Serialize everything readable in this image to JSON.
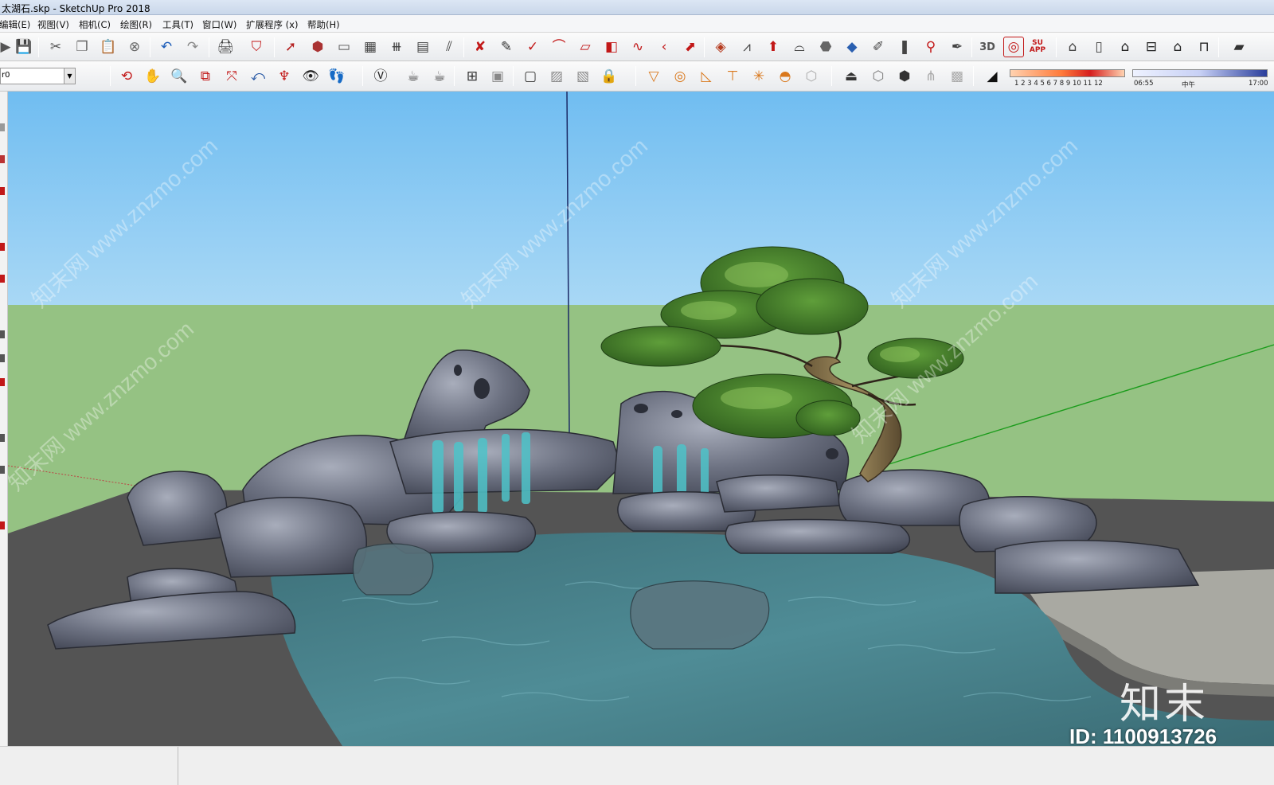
{
  "window": {
    "title": "太湖石.skp - SketchUp Pro 2018"
  },
  "menu": [
    "编辑(E)",
    "视图(V)",
    "相机(C)",
    "绘图(R)",
    "工具(T)",
    "窗口(W)",
    "扩展程序 (x)",
    "帮助(H)"
  ],
  "toolbar": {
    "layer_value": "r0",
    "shadow_months": "1 2 3 4 5 6 7 8 9 10 11 12",
    "shadow_time_start": "06:55",
    "shadow_time_mid": "中午",
    "shadow_time_end": "17:00",
    "su_app_label": "SU\nAPP"
  },
  "icons": {
    "row1": [
      "paste-icon",
      "save-icon",
      "cut-icon",
      "copy-icon",
      "paste-doc-icon",
      "erase-icon",
      "undo-icon",
      "redo-icon",
      "print-icon",
      "model-info-icon",
      "select-icon",
      "make-component-icon",
      "paint-icon",
      "grid-icon",
      "fence-icon",
      "stairs-icon",
      "ruler-icon",
      "check-red-icon",
      "pencil-icon",
      "tick-icon",
      "arc-icon",
      "eraser-red-icon",
      "follow-me-icon",
      "path-icon",
      "offset-icon",
      "push-red-icon",
      "material-box-icon",
      "roof-icon",
      "extrude-icon",
      "arc2-icon",
      "cube-gray-icon",
      "sandbox-icon",
      "edit-icon",
      "books-icon",
      "pin-icon",
      "pen-icon",
      "3d-icon",
      "layers-icon",
      "su-app-icon",
      "house-side-icon",
      "book-open-icon",
      "home-icon",
      "garage-icon",
      "house-icon",
      "shelter-icon",
      "sheet-icon"
    ],
    "row2": [
      "orbit-icon",
      "pan-icon",
      "zoom-icon",
      "zoom-window-icon",
      "zoom-extents-icon",
      "previous-icon",
      "position-camera-icon",
      "look-around-icon",
      "walk-icon",
      "vray-icon",
      "teapot-icon",
      "teapot2-icon",
      "xray-icon",
      "wireframe-icon",
      "hidden-line-icon",
      "shaded-icon",
      "textured-icon",
      "lock-icon",
      "section-icon",
      "circle-icon",
      "protractor-icon",
      "axes-icon",
      "light-icon",
      "dome-icon",
      "sphere-icon",
      "camera-icon",
      "iso-icon",
      "box-icon",
      "grass-icon",
      "fog-icon",
      "eraser-icon"
    ]
  },
  "viewport": {
    "sky_color": "#7fc4f1",
    "ground_color": "#95c283",
    "watermark_text": "知末网 www.znzmo.com",
    "brand": "知末",
    "image_id": "ID: 1100913726"
  }
}
